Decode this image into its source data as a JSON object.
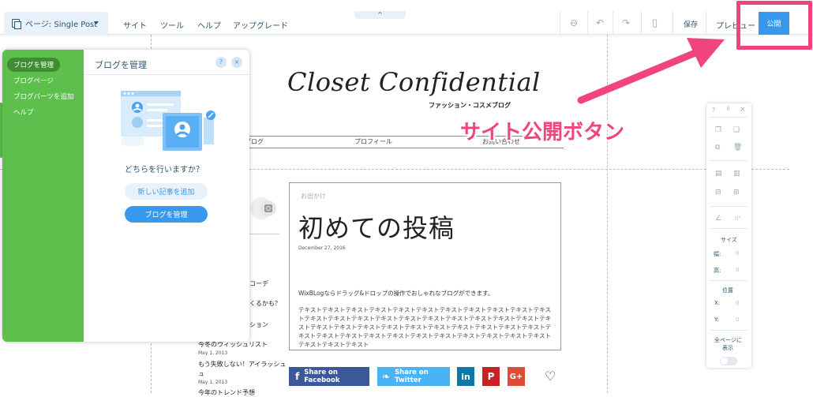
{
  "topbar": {
    "page_selector": "ページ: Single Post",
    "menu": [
      "サイト",
      "ツール",
      "ヘルプ",
      "アップグレード"
    ],
    "collapse_icon": "^",
    "zoom_icon": "zoom-out-icon",
    "undo_icon": "undo-icon",
    "redo_icon": "redo-icon",
    "mobile_icon": "mobile-icon",
    "save_label": "保存",
    "preview_label": "プレビュー",
    "publish_label": "公開"
  },
  "site": {
    "logo": "Closet Confidential",
    "tagline": "ファッション・コスメブログ",
    "nav": [
      "ブログ",
      "プロフィール",
      "お問い合わせ"
    ]
  },
  "sidebar_posts": {
    "items": [
      "コーデ",
      "くるかも？",
      "ション",
      "今冬のウィッシュリスト",
      "もう失敗しない！アイラッシュ",
      "May 1, 2013",
      "May 1, 2013",
      "今年のトレンド予想"
    ]
  },
  "post": {
    "category": "お出かけ",
    "title": "初めての投稿",
    "date": "December 27, 2016",
    "lead": "WixBLogならドラッグ&ドロップの操作でおしゃれなブログができます。",
    "body": "テキストテキストテキストテキストテキストテキストテキストテキストテキストテキストテキストテキストテキストテキストテキストテキストテキストテキストテキストテキストテキストテキストテキストテキストテキストテキストテキストテキストテキストテキストテキストテキストテキストテキストテキストテキストテキストテキストテキストテキストテキストテキストテキストテキストテキストテキスト"
  },
  "share": {
    "facebook": "Share on Facebook",
    "twitter": "Share on Twitter",
    "linkedin": "in",
    "pinterest": "P",
    "google": "G+"
  },
  "annotation": {
    "text": "サイト公開ボタン",
    "color": "#f0447f"
  },
  "blog_panel": {
    "nav": [
      "ブログを管理",
      "ブログページ",
      "ブログパーツを追加",
      "ヘルプ"
    ],
    "title": "ブログを管理",
    "help": "?",
    "close": "×",
    "question": "どちらを行いますか？",
    "new_post_button": "新しい記事を追加",
    "manage_button": "ブログを管理"
  },
  "tools_panel": {
    "help": "?",
    "close": "×",
    "rotation_value": "0°",
    "size_label": "サイズ",
    "width_label": "幅:",
    "width_value": "0",
    "height_label": "高:",
    "height_value": "0",
    "position_label": "位置",
    "x_label": "X:",
    "x_value": "0",
    "y_label": "Y:",
    "y_value": "0",
    "show_all_label_1": "全ページに",
    "show_all_label_2": "表示"
  },
  "colors": {
    "accent": "#3899ec",
    "panel_green": "#5dbf4c",
    "facebook": "#3b5998",
    "twitter": "#4ab3f4",
    "linkedin": "#0e76a8",
    "pinterest": "#cb2027",
    "google": "#dd4b39"
  }
}
